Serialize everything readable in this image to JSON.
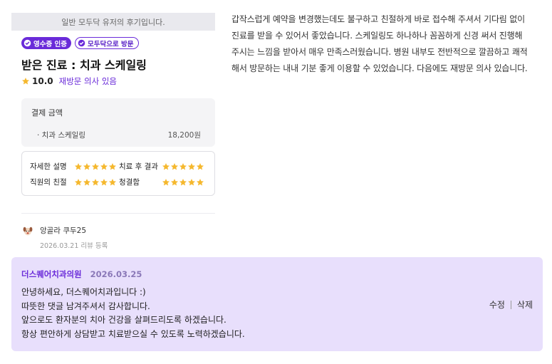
{
  "banner": "일반 모두닥 유저의 후기입니다.",
  "badges": [
    {
      "label": "영수증 인증",
      "icon": "check-circle-icon"
    },
    {
      "label": "모두닥으로 방문",
      "icon": "check-circle-icon"
    }
  ],
  "title": "받은 진료 : 치과 스케일링",
  "rating": {
    "score": "10.0",
    "revisit": "재방문 의사 있음"
  },
  "payment": {
    "label": "결제 금액",
    "item": "· 치과 스케일링",
    "price": "18,200원"
  },
  "scores": [
    {
      "label": "자세한 설명",
      "stars": 5
    },
    {
      "label": "치료 후 결과",
      "stars": 5
    },
    {
      "label": "직원의 친절",
      "stars": 5
    },
    {
      "label": "청결함",
      "stars": 5
    }
  ],
  "author": {
    "name": "앙골라 쿠두25",
    "date": "2026.03.21 리뷰 등록"
  },
  "review_text": "갑작스럽게 예약을 변경했는데도 불구하고 친절하게 바로 접수해 주셔서 기다림 없이 진료를 받을 수 있어서 좋았습니다. 스케일링도 하나하나 꼼꼼하게 신경 써서 진행해 주시는 느낌을 받아서 매우 만족스러웠습니다. 병원 내부도 전반적으로 깔끔하고 쾌적해서 방문하는 내내 기분 좋게 이용할 수 있었습니다. 다음에도 재방문 의사 있습니다.",
  "reply": {
    "hospital": "더스퀘어치과의원",
    "date": "2026.03.25",
    "lines": [
      "안녕하세요, 더스퀘어치과입니다 :)",
      "따뜻한 댓글 남겨주셔서 감사합니다.",
      "앞으로도 환자분의 치아 건강을 살펴드리도록 하겠습니다.",
      "항상 편안하게 상담받고 치료받으실 수 있도록 노력하겠습니다."
    ],
    "edit_label": "수정",
    "delete_label": "삭제"
  },
  "colors": {
    "accent": "#6a2bd9",
    "star": "#f5b82e",
    "reply_bg": "#e8dffc"
  }
}
